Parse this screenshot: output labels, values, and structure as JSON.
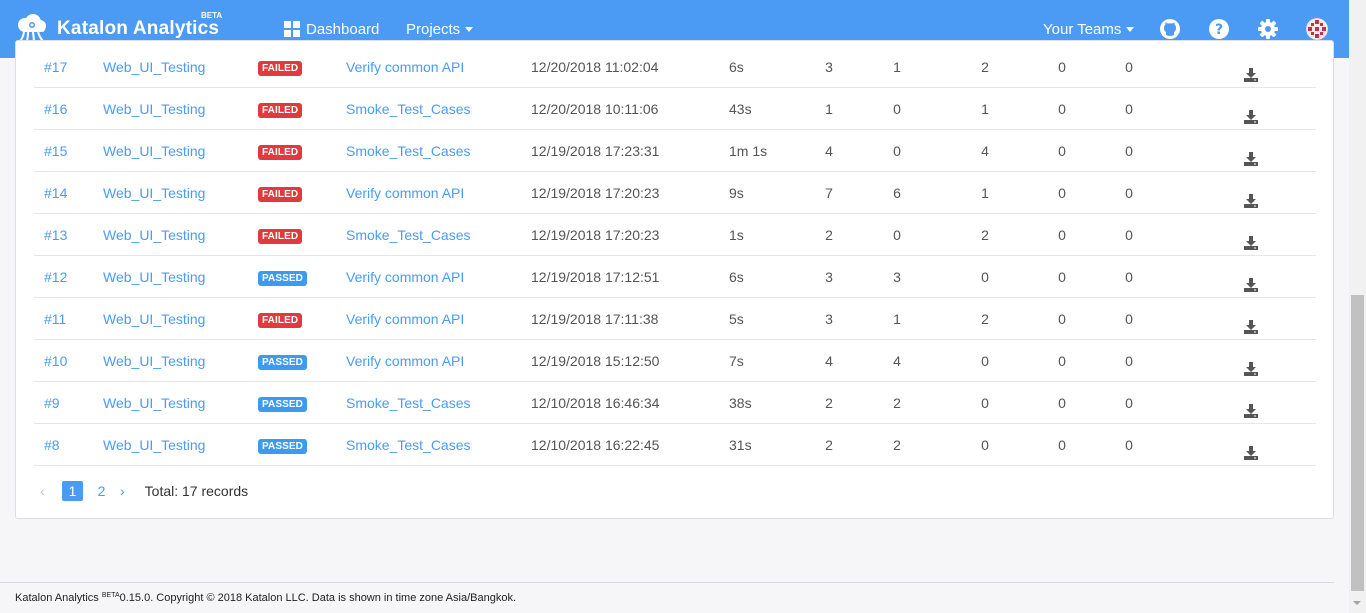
{
  "navbar": {
    "brand": "Katalon Analytics",
    "beta": "BETA",
    "dashboard": "Dashboard",
    "projects": "Projects",
    "teams": "Your Teams",
    "icons": [
      "github-icon",
      "help-icon",
      "gear-icon",
      "avatar"
    ]
  },
  "rows": [
    {
      "id": "#17",
      "project": "Web_UI_Testing",
      "status": "FAILED",
      "suite": "Verify common API",
      "time": "12/20/2018 11:02:04",
      "duration": "6s",
      "n1": "3",
      "n2": "1",
      "n3": "2",
      "n4": "0",
      "n5": "0"
    },
    {
      "id": "#16",
      "project": "Web_UI_Testing",
      "status": "FAILED",
      "suite": "Smoke_Test_Cases",
      "time": "12/20/2018 10:11:06",
      "duration": "43s",
      "n1": "1",
      "n2": "0",
      "n3": "1",
      "n4": "0",
      "n5": "0"
    },
    {
      "id": "#15",
      "project": "Web_UI_Testing",
      "status": "FAILED",
      "suite": "Smoke_Test_Cases",
      "time": "12/19/2018 17:23:31",
      "duration": "1m 1s",
      "n1": "4",
      "n2": "0",
      "n3": "4",
      "n4": "0",
      "n5": "0"
    },
    {
      "id": "#14",
      "project": "Web_UI_Testing",
      "status": "FAILED",
      "suite": "Verify common API",
      "time": "12/19/2018 17:20:23",
      "duration": "9s",
      "n1": "7",
      "n2": "6",
      "n3": "1",
      "n4": "0",
      "n5": "0"
    },
    {
      "id": "#13",
      "project": "Web_UI_Testing",
      "status": "FAILED",
      "suite": "Smoke_Test_Cases",
      "time": "12/19/2018 17:20:23",
      "duration": "1s",
      "n1": "2",
      "n2": "0",
      "n3": "2",
      "n4": "0",
      "n5": "0"
    },
    {
      "id": "#12",
      "project": "Web_UI_Testing",
      "status": "PASSED",
      "suite": "Verify common API",
      "time": "12/19/2018 17:12:51",
      "duration": "6s",
      "n1": "3",
      "n2": "3",
      "n3": "0",
      "n4": "0",
      "n5": "0"
    },
    {
      "id": "#11",
      "project": "Web_UI_Testing",
      "status": "FAILED",
      "suite": "Verify common API",
      "time": "12/19/2018 17:11:38",
      "duration": "5s",
      "n1": "3",
      "n2": "1",
      "n3": "2",
      "n4": "0",
      "n5": "0"
    },
    {
      "id": "#10",
      "project": "Web_UI_Testing",
      "status": "PASSED",
      "suite": "Verify common API",
      "time": "12/19/2018 15:12:50",
      "duration": "7s",
      "n1": "4",
      "n2": "4",
      "n3": "0",
      "n4": "0",
      "n5": "0"
    },
    {
      "id": "#9",
      "project": "Web_UI_Testing",
      "status": "PASSED",
      "suite": "Smoke_Test_Cases",
      "time": "12/10/2018 16:46:34",
      "duration": "38s",
      "n1": "2",
      "n2": "2",
      "n3": "0",
      "n4": "0",
      "n5": "0"
    },
    {
      "id": "#8",
      "project": "Web_UI_Testing",
      "status": "PASSED",
      "suite": "Smoke_Test_Cases",
      "time": "12/10/2018 16:22:45",
      "duration": "31s",
      "n1": "2",
      "n2": "2",
      "n3": "0",
      "n4": "0",
      "n5": "0"
    }
  ],
  "pagination": {
    "prev": "‹",
    "page1": "1",
    "page2": "2",
    "next": "›",
    "total": "Total: 17 records"
  },
  "footer": {
    "brand": "Katalon Analytics ",
    "beta": "BETA",
    "text": "0.15.0. Copyright © 2018 Katalon LLC. Data is shown in time zone Asia/Bangkok."
  },
  "colors": {
    "navbar": "#4b9bf5",
    "failed": "#e0393e",
    "passed": "#3c9bf0",
    "link": "#4b9bf5"
  }
}
